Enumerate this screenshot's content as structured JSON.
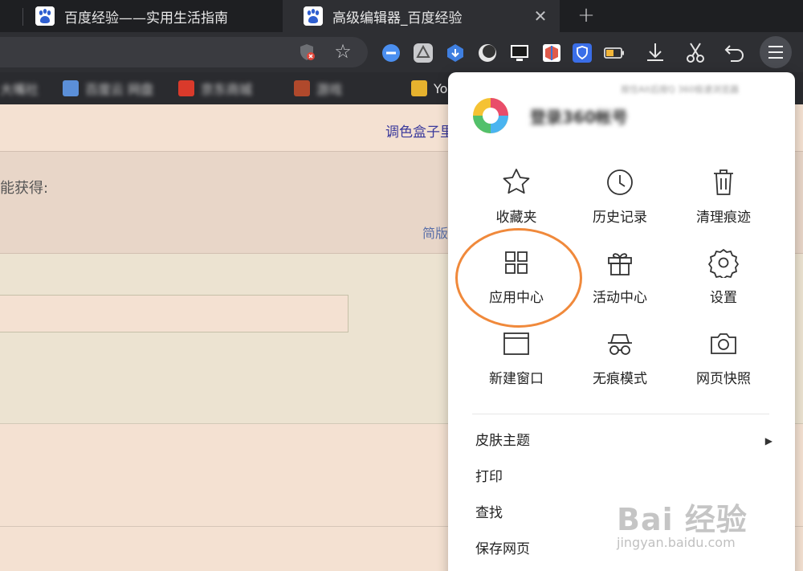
{
  "tabs": [
    {
      "title": "百度经验——实用生活指南",
      "active": false
    },
    {
      "title": "高级编辑器_百度经验",
      "active": true
    }
  ],
  "new_tab_label": "+",
  "close_label": "✕",
  "bookmarks": [
    {
      "label": "大嘴社",
      "color": "#d9ae3a"
    },
    {
      "label": "百度云 网盘",
      "color": "#5b8fd8"
    },
    {
      "label": "京东商城",
      "color": "#d93a2b"
    },
    {
      "label": "游戏",
      "color": "#b0492c"
    },
    {
      "label": "Yo",
      "color": "#e6b22e"
    }
  ],
  "page": {
    "top_link": "调色盒子里",
    "band_text": "能获得:",
    "simple_link": "简版"
  },
  "menu": {
    "account_label": "登录360帐号",
    "hint": "按住Alt后按Q 360极速浏览器",
    "grid": [
      {
        "label": "收藏夹",
        "icon": "star-icon"
      },
      {
        "label": "历史记录",
        "icon": "clock-icon"
      },
      {
        "label": "清理痕迹",
        "icon": "trash-icon"
      },
      {
        "label": "应用中心",
        "icon": "apps-grid-icon"
      },
      {
        "label": "活动中心",
        "icon": "gift-icon"
      },
      {
        "label": "设置",
        "icon": "gear-icon"
      },
      {
        "label": "新建窗口",
        "icon": "window-icon"
      },
      {
        "label": "无痕模式",
        "icon": "incognito-icon"
      },
      {
        "label": "网页快照",
        "icon": "camera-icon"
      }
    ],
    "rows": [
      {
        "label": "皮肤主题",
        "has_submenu": true
      },
      {
        "label": "打印",
        "has_submenu": false
      },
      {
        "label": "查找",
        "has_submenu": false
      },
      {
        "label": "保存网页",
        "has_submenu": false
      }
    ],
    "submenu_arrow": "▶"
  },
  "watermark": {
    "text": "Bai 经验",
    "url": "jingyan.baidu.com"
  },
  "colors": {
    "highlight": "#f0893b",
    "accent": "#3b3a9c"
  }
}
